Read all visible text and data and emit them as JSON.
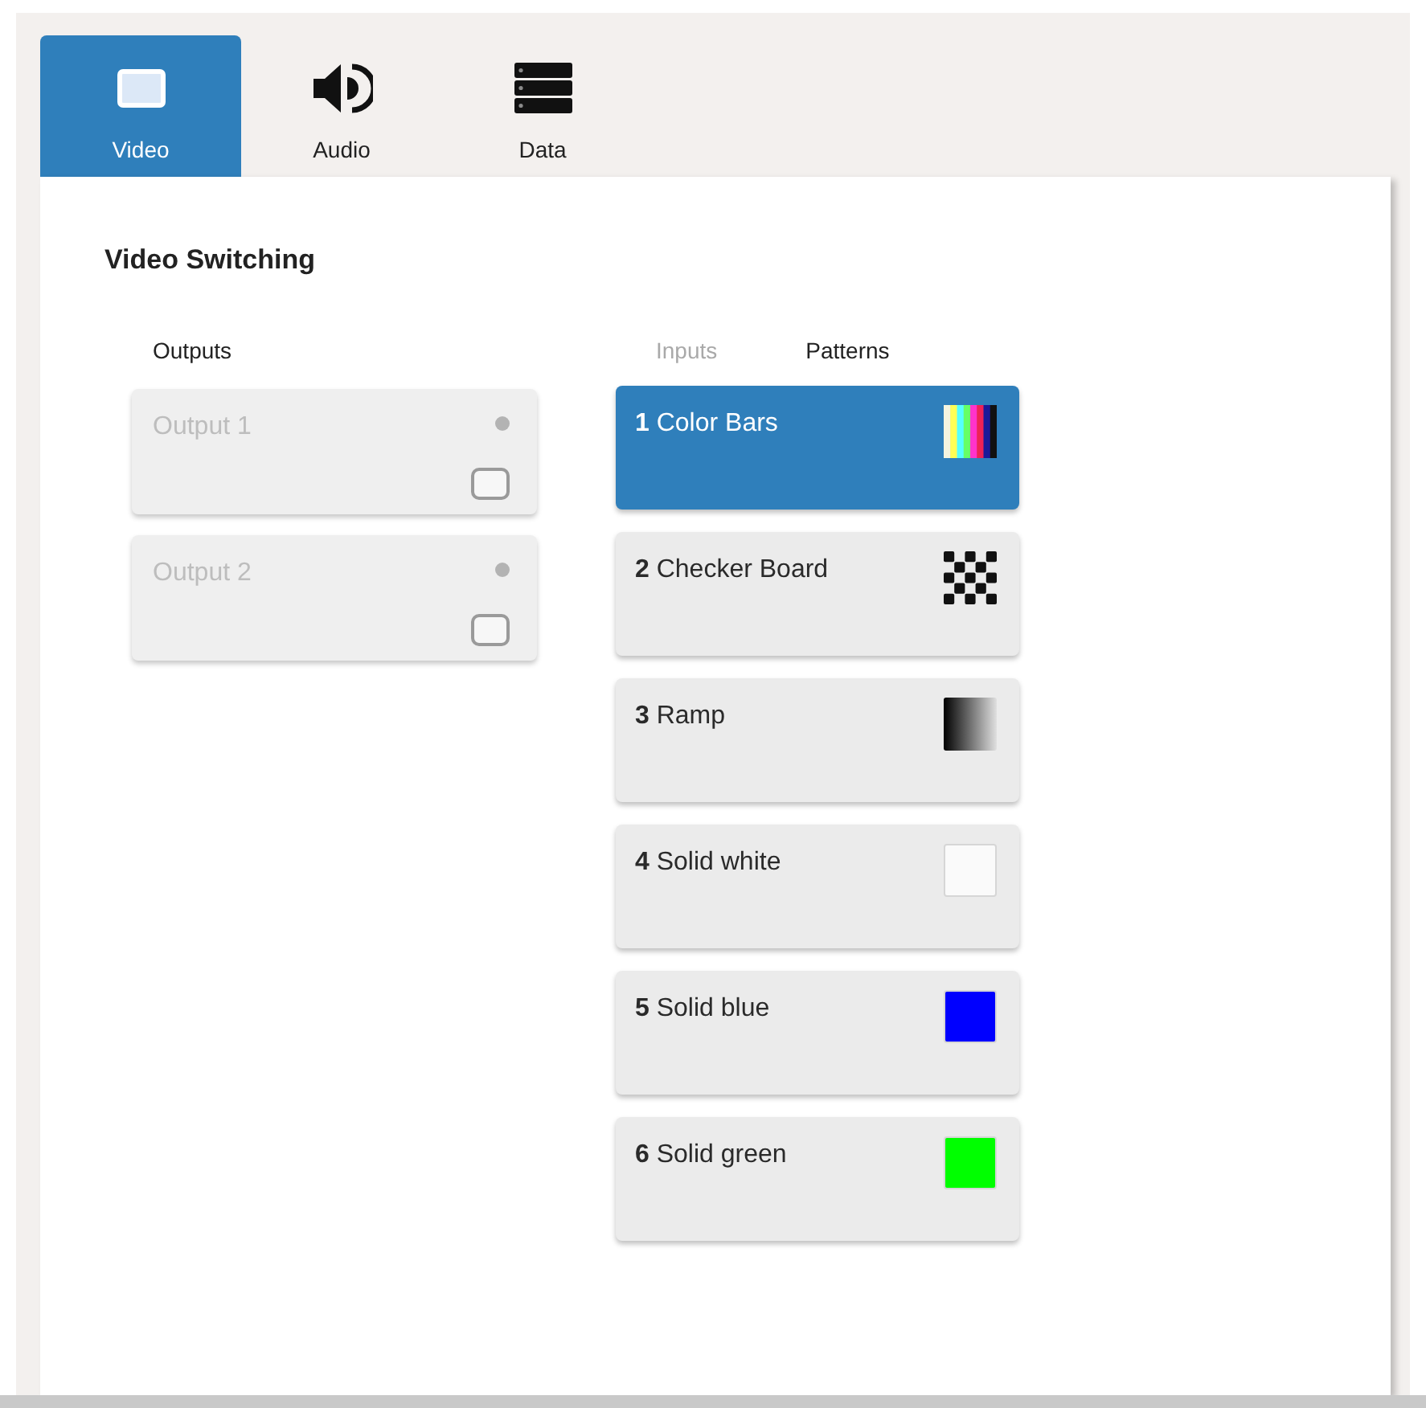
{
  "tabs": [
    {
      "label": "Video",
      "kind": "monitor",
      "selected": true
    },
    {
      "label": "Audio",
      "kind": "speaker",
      "selected": false
    },
    {
      "label": "Data",
      "kind": "server",
      "selected": false
    }
  ],
  "section": {
    "title": "Video Switching"
  },
  "outputs": {
    "heading": "Outputs",
    "items": [
      {
        "label": "Output 1",
        "disabled": true,
        "checked": false
      },
      {
        "label": "Output 2",
        "disabled": true,
        "checked": false
      }
    ]
  },
  "sources": {
    "tabs": [
      {
        "label": "Inputs",
        "selected": false
      },
      {
        "label": "Patterns",
        "selected": true
      }
    ],
    "patterns": [
      {
        "label": "**1** Color Bars",
        "kind": "bars",
        "selected": true
      },
      {
        "label": "**2** Checker Board",
        "kind": "checker",
        "selected": false
      },
      {
        "label": "**3** Ramp",
        "kind": "ramp",
        "selected": false
      },
      {
        "label": "**4** Solid white",
        "kind": "solid",
        "color": "#fafafa",
        "selected": false
      },
      {
        "label": "**5** Solid blue",
        "kind": "solid",
        "color": "#0000ff",
        "selected": false
      },
      {
        "label": "**6** Solid green",
        "kind": "solid",
        "color": "#00ff00",
        "selected": false
      }
    ]
  }
}
